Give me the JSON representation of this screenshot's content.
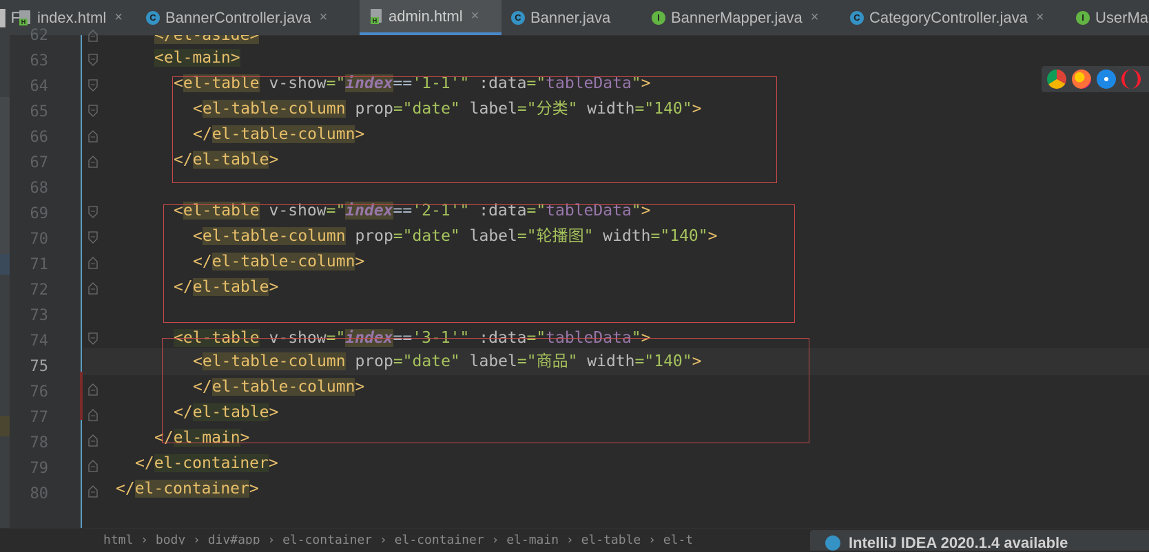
{
  "tabs": [
    {
      "label": "index.html",
      "icon": "html-file-icon",
      "active": false
    },
    {
      "label": "BannerController.java",
      "icon": "java-class-icon",
      "active": false
    },
    {
      "label": "admin.html",
      "icon": "html-file-icon",
      "active": true
    },
    {
      "label": "Banner.java",
      "icon": "java-class-icon",
      "active": false
    },
    {
      "label": "BannerMapper.java",
      "icon": "java-interface-icon",
      "active": false
    },
    {
      "label": "CategoryController.java",
      "icon": "java-class-icon",
      "active": false
    },
    {
      "label": "UserMa",
      "icon": "java-interface-icon",
      "active": false
    }
  ],
  "tab_icon_letters": {
    "class": "C",
    "interface": "I",
    "html": "H"
  },
  "close_glyph": "×",
  "editor": {
    "current_line": "75",
    "line_numbers": [
      "62",
      "63",
      "64",
      "65",
      "66",
      "67",
      "68",
      "69",
      "70",
      "71",
      "72",
      "73",
      "74",
      "75",
      "76",
      "77",
      "78",
      "79",
      "80"
    ],
    "top_partial_code": "</el-aside>",
    "code": {
      "l63": {
        "open": "<el-main>"
      },
      "l64": {
        "tag": "el-table",
        "vshow_attr": "v-show",
        "q1": "=\"",
        "index_var": "index",
        "op": "==",
        "value": "'1-1'",
        "q2": "\"",
        "data_attr": ":data",
        "q3": "=\"",
        "data_value": "tableData",
        "q4": "\"",
        "close": ">"
      },
      "l65": {
        "tag": "el-table-column",
        "prop_attr": "prop",
        "prop_value": "=\"date\"",
        "label_attr": "label",
        "label_value": "=\"分类\"",
        "width_attr": "width",
        "width_value": "=\"140\"",
        "close": ">"
      },
      "l66": {
        "close_tag": "el-table-column"
      },
      "l67": {
        "close_tag": "el-table"
      },
      "l69": {
        "tag": "el-table",
        "vshow_attr": "v-show",
        "q1": "=\"",
        "index_var": "index",
        "op": "==",
        "value": "'2-1'",
        "q2": "\"",
        "data_attr": ":data",
        "q3": "=\"",
        "data_value": "tableData",
        "q4": "\"",
        "close": ">"
      },
      "l70": {
        "tag": "el-table-column",
        "prop_attr": "prop",
        "prop_value": "=\"date\"",
        "label_attr": "label",
        "label_value": "=\"轮播图\"",
        "width_attr": "width",
        "width_value": "=\"140\"",
        "close": ">"
      },
      "l71": {
        "close_tag": "el-table-column"
      },
      "l72": {
        "close_tag": "el-table"
      },
      "l74": {
        "tag": "el-table",
        "vshow_attr": "v-show",
        "q1": "=\"",
        "index_var": "index",
        "op": "==",
        "value": "'3-1'",
        "q2": "\"",
        "data_attr": ":data",
        "q3": "=\"",
        "data_value": "tableData",
        "q4": "\"",
        "close": ">"
      },
      "l75": {
        "tag": "el-table-column",
        "prop_attr": "prop",
        "prop_value": "=\"date\"",
        "label_attr": "label",
        "label_value": "=\"商品\"",
        "width_attr": "width",
        "width_value": "=\"140\"",
        "close": ">"
      },
      "l76": {
        "close_tag": "el-table-column"
      },
      "l77": {
        "close_tag": "el-table"
      },
      "l78": {
        "close_tag": "el-main"
      },
      "l79": {
        "close_tag": "el-container"
      },
      "l80": {
        "close_tag": "el-container"
      }
    }
  },
  "breadcrumb_fragment": "html › body › div#app › el-container › el-container › el-main › el-table › el-t",
  "notification_fragment": "IntelliJ IDEA 2020.1.4 available",
  "browser_icons": [
    "chrome-icon",
    "firefox-icon",
    "safari-icon",
    "opera-icon"
  ],
  "colors": {
    "tag": "#e8bf6a",
    "attr": "#bababa",
    "string": "#a5c25c",
    "variable": "#9876aa",
    "box": "#c94a4a",
    "background": "#2b2b2b",
    "tab_accent": "#4a88c7"
  }
}
